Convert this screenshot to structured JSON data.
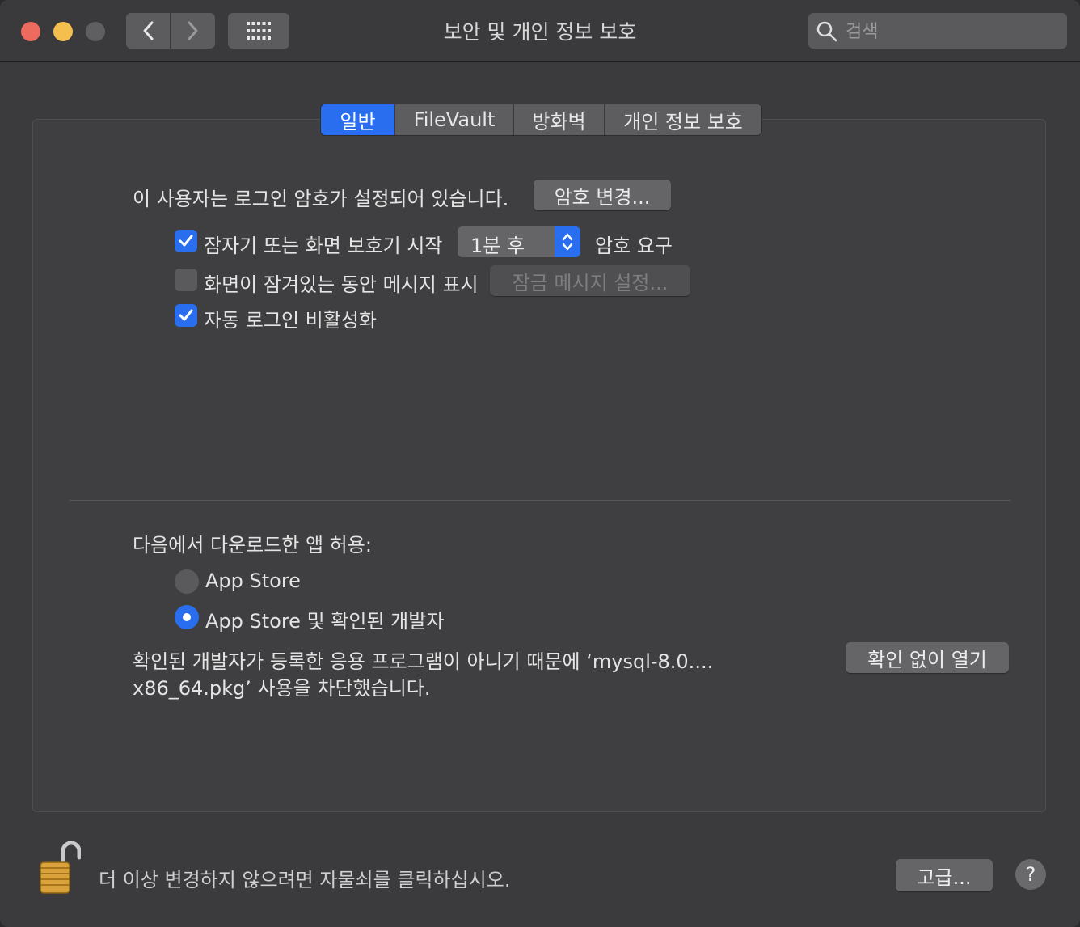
{
  "window": {
    "title": "보안 및 개인 정보 보호",
    "search_placeholder": "검색"
  },
  "tabs": [
    {
      "label": "일반",
      "active": true
    },
    {
      "label": "FileVault",
      "active": false
    },
    {
      "label": "방화벽",
      "active": false
    },
    {
      "label": "개인 정보 보호",
      "active": false
    }
  ],
  "general": {
    "password_text": "이 사용자는 로그인 암호가 설정되어 있습니다.",
    "change_password_button": "암호 변경...",
    "require_password": {
      "label": "잠자기 또는 화면 보호기 시작",
      "checked": true,
      "delay_value": "1분 후",
      "suffix": "암호 요구"
    },
    "show_message": {
      "label": "화면이 잠겨있는 동안 메시지 표시",
      "checked": false,
      "button": "잠금 메시지 설정..."
    },
    "disable_auto_login": {
      "label": "자동 로그인 비활성화",
      "checked": true
    }
  },
  "downloads": {
    "heading": "다음에서 다운로드한 앱 허용:",
    "options": [
      {
        "label": "App Store",
        "selected": false
      },
      {
        "label": "App Store 및 확인된 개발자",
        "selected": true
      }
    ],
    "blocked_line1": "확인된 개발자가 등록한 응용 프로그램이 아니기 때문에 ‘mysql-8.0....",
    "blocked_line2": "x86_64.pkg’ 사용을 차단했습니다.",
    "open_anyway_button": "확인 없이 열기"
  },
  "footer": {
    "lock_text": "더 이상 변경하지 않으려면 자물쇠를 클릭하십시오.",
    "advanced_button": "고급...",
    "help_label": "?"
  },
  "colors": {
    "accent": "#2a6ef0",
    "close": "#ed6a5e",
    "minimize": "#f5bf4f"
  }
}
